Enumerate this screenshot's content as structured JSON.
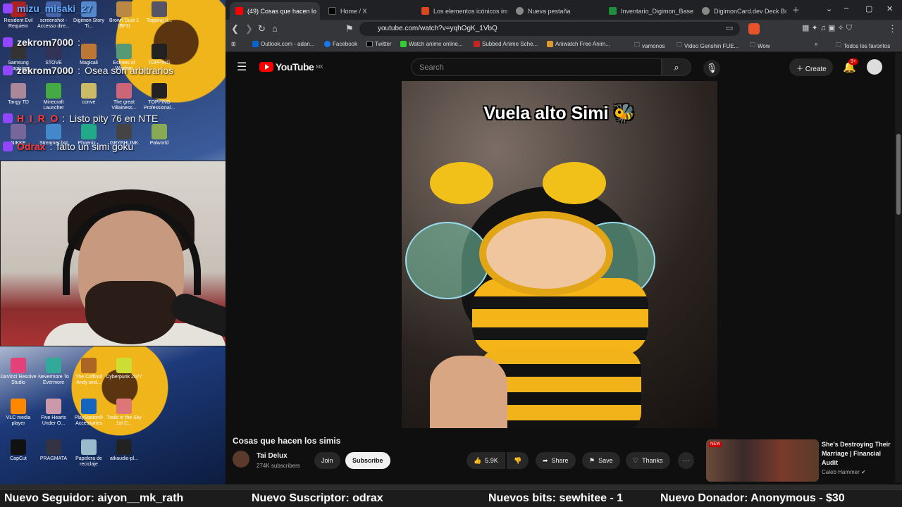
{
  "stream_overlay": {
    "chat": [
      {
        "user": "mizu_misaki_27",
        "sep": " ",
        "text": ""
      },
      {
        "user": "zekrom7000",
        "sep": " : ",
        "text": ""
      },
      {
        "user": "zekrom7000",
        "sep": " : ",
        "text": "Osea son arbitrarios"
      },
      {
        "user": "H_I_R_O",
        "sep": " : ",
        "text": "Listo pity 76 en NTE"
      },
      {
        "user": "Odrax",
        "sep": " : ",
        "text": "falto un simi goku"
      }
    ],
    "desktop_icons_top": [
      "Resident Evil Requiem",
      "screenshot - Accesso dire...",
      "Digimon Story Ti...",
      "Brown Dust 2 (BP3)",
      "Topping II..."
    ],
    "desktop_icons_row2": [
      "Samsung Magician",
      "STOVE",
      "Magicali",
      "Echoes of Wisdom",
      "TOPPING"
    ],
    "desktop_icons_row3": [
      "Tangy TD",
      "Minecraft Launcher",
      "conve",
      "The great Villainess...",
      "TOPPING Professional..."
    ],
    "desktop_icons_row4": [
      "NIKKE",
      "Streamer.bot",
      "Phoenix...",
      "GRYPHLINK",
      "Palworld"
    ],
    "desktop_icons_bottom1": [
      "DaVinci Resolve Studio",
      "Nevermore To Evermore",
      "The Coffinof Andy and...",
      "Cyberpunk 2077"
    ],
    "desktop_icons_bottom2": [
      "VLC media player",
      "Five Hearts Under O...",
      "PlayStation® Accessories",
      "Trails in the Sky 1st C..."
    ],
    "desktop_icons_bottom3": [
      "CapCut",
      "PRAGMATA",
      "Papelera de reciclaje",
      "atkaudio-pl..."
    ]
  },
  "browser": {
    "tabs": [
      {
        "label": "(49) Cosas que hacen lo",
        "color": "#ff0000"
      },
      {
        "label": "Home / X",
        "color": "#000000"
      },
      {
        "label": "Los elementos icónicos insp",
        "color": "#d9481f"
      },
      {
        "label": "Nueva pestaña",
        "color": "#888888"
      },
      {
        "label": "Inventario_Digimon_Base -",
        "color": "#1e8e3e"
      },
      {
        "label": "DigimonCard.dev Deck Buil",
        "color": "#888888"
      }
    ],
    "url": "youtube.com/watch?v=yqhOgK_1VbQ",
    "bookmarks": [
      "Outlook.com - adan...",
      "Facebook",
      "Twitter",
      "Watch anime online...",
      "Subbed Anime Sche...",
      "Aniwatch Free Anim...",
      "vamonos",
      "Video Genshin FUE...",
      "Wow",
      "Todos los favoritos"
    ]
  },
  "youtube": {
    "logo": "YouTube",
    "region": "MX",
    "search_placeholder": "Search",
    "create_label": "Create",
    "notif_count": "9+",
    "video_caption": "Vuela alto Simi",
    "video_title": "Cosas que hacen los simis",
    "channel_name": "Tai Delux",
    "channel_subs": "274K subscribers",
    "join_label": "Join",
    "subscribe_label": "Subscribe",
    "likes": "5.9K",
    "share_label": "Share",
    "save_label": "Save",
    "thanks_label": "Thanks",
    "recommended": {
      "badge": "NEW",
      "title": "She's Destroying Their Marriage | Financial Audit",
      "author": "Caleb Hammer"
    }
  },
  "ticker": {
    "follower": "Nuevo Seguidor: aiyon__mk_rath",
    "subscriber": "Nuevo Suscriptor: odrax",
    "bits": "Nuevos bits: sewhitee - 1",
    "donor": "Nuevo Donador: Anonymous - $30"
  }
}
